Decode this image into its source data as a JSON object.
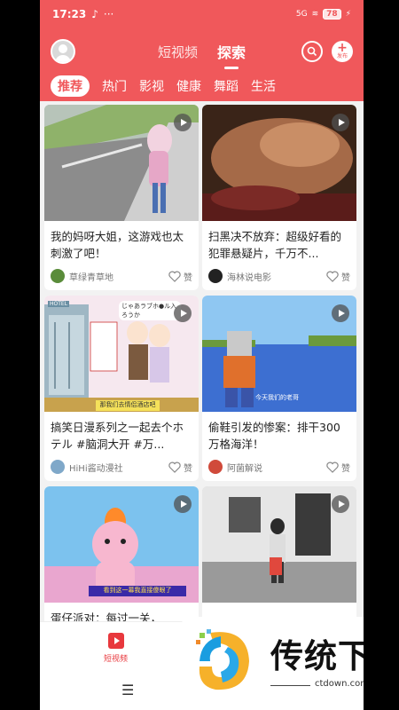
{
  "status": {
    "time": "17:23",
    "dots": "···",
    "signal": "5G",
    "battery": "78"
  },
  "header": {
    "tabs": [
      "短视频",
      "探索"
    ],
    "active_tab": 1,
    "publish_label": "发布"
  },
  "categories": [
    "推荐",
    "热门",
    "影视",
    "健康",
    "舞蹈",
    "生活"
  ],
  "cards": [
    {
      "title": "我的妈呀大姐，这游戏也太刺激了吧！",
      "user": "草绿青草地",
      "like": "赞"
    },
    {
      "title": "扫黑决不放弃：超级好看的犯罪悬疑片，千万不...",
      "user": "海林说电影",
      "like": "赞"
    },
    {
      "title": "搞笑日漫系列之一起去个ホテル #脑洞大开 #万...",
      "user": "HiHi酱动漫社",
      "like": "赞"
    },
    {
      "title": "偷鞋引发的惨案：排干300万格海洋！",
      "user": "阿菌解说",
      "like": "赞"
    },
    {
      "title": "蛋仔派对：每过一关，",
      "user": "",
      "like": ""
    },
    {
      "title": "",
      "user": "",
      "like": ""
    }
  ],
  "thumb_text": {
    "manga_tag": "HOTEL",
    "manga_speech": "じゃあラブホ●ル入ろうか",
    "manga_caption": "那我们去情侣酒店吧",
    "minecraft_caption": "今天我们的老哥",
    "danzai_caption": "看到这一幕我直接傻眼了"
  },
  "bottom_nav": {
    "label": "短视频"
  },
  "watermark": {
    "name": "传统下载",
    "url": "ctdown.com"
  },
  "colors": {
    "brand": "#f0585b",
    "nav_accent": "#e8383d"
  }
}
